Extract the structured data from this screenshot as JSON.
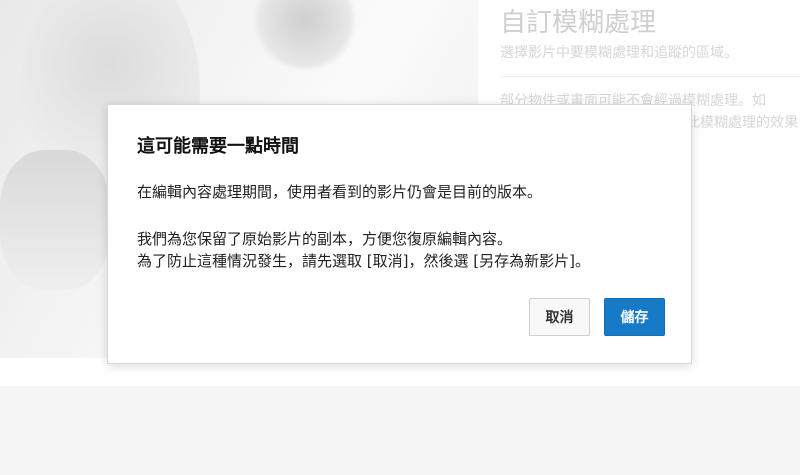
{
  "background": {
    "panel_title": "自訂模糊處理",
    "panel_subtitle": "選擇影片中要模糊處理和追蹤的區域。",
    "panel_note_line1": "部分物件或畫面可能不會經過模糊處理。如",
    "panel_note_line2": "此模糊處理的效果"
  },
  "dialog": {
    "title": "這可能需要一點時間",
    "paragraph1": "在編輯內容處理期間，使用者看到的影片仍會是目前的版本。",
    "paragraph2_line1": "我們為您保留了原始影片的副本，方便您復原編輯內容。",
    "paragraph2_line2": "為了防止這種情況發生，請先選取 [取消]，然後選 [另存為新影片]。",
    "cancel_label": "取消",
    "save_label": "儲存"
  },
  "colors": {
    "primary_button": "#167ac6",
    "secondary_button": "#f8f8f8"
  }
}
